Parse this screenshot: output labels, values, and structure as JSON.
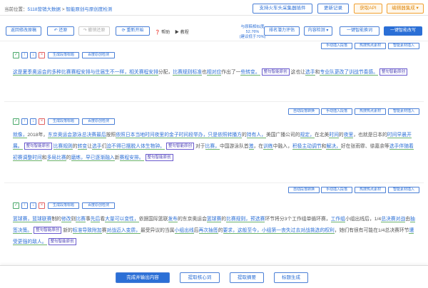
{
  "topbar": {
    "crumb_prefix": "当前位置：",
    "crumb_link": "5118营销大数据",
    "crumb_sep": ">",
    "crumb_current": "智能原创与原创度检测",
    "plugin_btn": "支持火车头采集器插件",
    "update_btn": "更新记录",
    "api_btn": "获取API",
    "editor_btn": "编辑器集成 ▾"
  },
  "toolbar": {
    "back_edit": "返回修改原稿",
    "restore": "还原",
    "undo_restore": "撤销还原",
    "restart": "重新开始",
    "help": "帮助",
    "tutorial": "教程",
    "similarity_line1": "与原稿相似度 52.76%",
    "similarity_line2": "(建议低于70%)",
    "rank_eval": "排名潜力评估",
    "content_check": "内容检测 ▾",
    "one_click_replace": "一键智能换词",
    "one_click_rewrite": "一键智能改写"
  },
  "row_tags": {
    "manual_insert": "手动插入段落",
    "hot_material": "热搜热点素材",
    "smart_insert": "智能素材插入",
    "auto_split": "自动段落转换",
    "gen_title": "生成段落标题",
    "baidu_check": "百度原创检测",
    "smart_orig": "整句智能原创"
  },
  "paragraphs": [
    {
      "segments": [
        {
          "t": "这是夏季奥运会的",
          "c": "s"
        },
        {
          "t": "多种",
          "c": "s"
        },
        {
          "t": "比赛",
          "c": "s"
        },
        {
          "t": "赛程安排",
          "c": "s"
        },
        {
          "t": "与往届生不一样，",
          "c": "s"
        },
        {
          "t": "相关",
          "c": "s"
        },
        {
          "t": "赛程安排",
          "c": "s"
        },
        {
          "t": "分配，",
          "c": "o"
        },
        {
          "t": "比赛规则",
          "c": "s"
        },
        {
          "t": "标准",
          "c": "s"
        },
        {
          "t": "也",
          "c": "o"
        },
        {
          "t": "相对应",
          "c": "s"
        },
        {
          "t": "作出了一",
          "c": "o"
        },
        {
          "t": "些",
          "c": "s"
        },
        {
          "t": "转变。",
          "c": "s"
        },
        {
          "t": "整句智能原创",
          "c": "sm"
        },
        {
          "t": "这也让",
          "c": "o"
        },
        {
          "t": "选手",
          "c": "s"
        },
        {
          "t": "和",
          "c": "o"
        },
        {
          "t": "专业队",
          "c": "s"
        },
        {
          "t": "更改了",
          "c": "s"
        },
        {
          "t": "训战",
          "c": "s"
        },
        {
          "t": "节奏感。",
          "c": "s"
        },
        {
          "t": "整句智能原创",
          "c": "sm"
        }
      ]
    },
    {
      "segments": [
        {
          "t": "就像，",
          "c": "s"
        },
        {
          "t": "2018年，",
          "c": "o"
        },
        {
          "t": "东京奥运会",
          "c": "s"
        },
        {
          "t": "游泳",
          "c": "s"
        },
        {
          "t": "总决赛",
          "c": "s"
        },
        {
          "t": "最后",
          "c": "s"
        },
        {
          "t": "按照",
          "c": "o"
        },
        {
          "t": "依照",
          "c": "s"
        },
        {
          "t": "日本当地时间",
          "c": "s"
        },
        {
          "t": "夜里的",
          "c": "s"
        },
        {
          "t": "金子",
          "c": "s"
        },
        {
          "t": "时间段",
          "c": "s"
        },
        {
          "t": "举办，",
          "c": "s"
        },
        {
          "t": "只是",
          "c": "s"
        },
        {
          "t": "依照",
          "c": "s"
        },
        {
          "t": "转播方",
          "c": "s"
        },
        {
          "t": "的",
          "c": "o"
        },
        {
          "t": "持有人，",
          "c": "s"
        },
        {
          "t": "美国广播公司的",
          "c": "o"
        },
        {
          "t": "规定，",
          "c": "s"
        },
        {
          "t": "在北美",
          "c": "o"
        },
        {
          "t": "时间",
          "c": "s"
        },
        {
          "t": "的",
          "c": "o"
        },
        {
          "t": "夜里",
          "c": "s"
        },
        {
          "t": "，也就是日本的",
          "c": "o"
        },
        {
          "t": "时间",
          "c": "s"
        },
        {
          "t": "早晨",
          "c": "s"
        },
        {
          "t": "开展。",
          "c": "s"
        },
        {
          "t": "整句智能原创",
          "c": "sm"
        },
        {
          "t": "比赛规则",
          "c": "s"
        },
        {
          "t": "的",
          "c": "o"
        },
        {
          "t": "转变",
          "c": "s"
        },
        {
          "t": "让",
          "c": "o"
        },
        {
          "t": "选手",
          "c": "s"
        },
        {
          "t": "们",
          "c": "o"
        },
        {
          "t": "迫不得已",
          "c": "s"
        },
        {
          "t": "摆脱",
          "c": "s"
        },
        {
          "t": "人体生物钟。",
          "c": "s"
        },
        {
          "t": "整句智能原创",
          "c": "sm"
        },
        {
          "t": "对于",
          "c": "o"
        },
        {
          "t": "比赛，",
          "c": "s"
        },
        {
          "t": "中国游泳队",
          "c": "o"
        },
        {
          "t": "首",
          "c": "o"
        },
        {
          "t": "激",
          "c": "s"
        },
        {
          "t": "，在",
          "c": "o"
        },
        {
          "t": "训练",
          "c": "s"
        },
        {
          "t": "中融入，",
          "c": "o"
        },
        {
          "t": "积极主动",
          "c": "s"
        },
        {
          "t": "调节",
          "c": "s"
        },
        {
          "t": "和",
          "c": "o"
        },
        {
          "t": "解决，",
          "c": "s"
        },
        {
          "t": "好在张雨霏、徐嘉余等",
          "c": "o"
        },
        {
          "t": "选手",
          "c": "s"
        },
        {
          "t": "伴随着",
          "c": "s"
        },
        {
          "t": "初赛",
          "c": "s"
        },
        {
          "t": "调整",
          "c": "s"
        },
        {
          "t": "时间",
          "c": "s"
        },
        {
          "t": "和",
          "c": "o"
        },
        {
          "t": "多局",
          "c": "s"
        },
        {
          "t": "比赛",
          "c": "s"
        },
        {
          "t": "的",
          "c": "o"
        },
        {
          "t": "磨练，",
          "c": "s"
        },
        {
          "t": "早已",
          "c": "s"
        },
        {
          "t": "逐渐融入",
          "c": "s"
        },
        {
          "t": "新",
          "c": "o"
        },
        {
          "t": "赛程安排。",
          "c": "s"
        },
        {
          "t": "整句智能原创",
          "c": "sm"
        }
      ]
    },
    {
      "segments": [
        {
          "t": "篮球赛，",
          "c": "s"
        },
        {
          "t": "篮球联赛",
          "c": "s"
        },
        {
          "t": "制的",
          "c": "o"
        },
        {
          "t": "修改",
          "c": "s"
        },
        {
          "t": "则",
          "c": "o"
        },
        {
          "t": "比赛",
          "c": "s"
        },
        {
          "t": "事",
          "c": "o"
        },
        {
          "t": "先后",
          "c": "s"
        },
        {
          "t": "看",
          "c": "o"
        },
        {
          "t": "大量",
          "c": "s"
        },
        {
          "t": "可以",
          "c": "s"
        },
        {
          "t": "变性，",
          "c": "s"
        },
        {
          "t": "依据国际篮联",
          "c": "o"
        },
        {
          "t": "发布",
          "c": "s"
        },
        {
          "t": "的东京奥运会",
          "c": "o"
        },
        {
          "t": "篮球赛",
          "c": "s"
        },
        {
          "t": "的",
          "c": "o"
        },
        {
          "t": "比赛规则，",
          "c": "s"
        },
        {
          "t": "预选赛",
          "c": "s"
        },
        {
          "t": "环节将分3个工作组单循环赛，",
          "c": "o"
        },
        {
          "t": "工作组",
          "c": "s"
        },
        {
          "t": "小组出线后，1/4",
          "c": "o"
        },
        {
          "t": "总决赛",
          "c": "s"
        },
        {
          "t": "对战",
          "c": "s"
        },
        {
          "t": "由",
          "c": "o"
        },
        {
          "t": "抽签",
          "c": "s"
        },
        {
          "t": "决策。",
          "c": "s"
        },
        {
          "t": "整句智能原创",
          "c": "sm"
        },
        {
          "t": "新的",
          "c": "o"
        },
        {
          "t": "标准",
          "c": "s"
        },
        {
          "t": "导致",
          "c": "s"
        },
        {
          "t": "附加",
          "c": "s"
        },
        {
          "t": "赛",
          "c": "o"
        },
        {
          "t": "对战",
          "c": "s"
        },
        {
          "t": "迈入",
          "c": "s"
        },
        {
          "t": "变质，",
          "c": "s"
        },
        {
          "t": "最受异议的当属",
          "c": "o"
        },
        {
          "t": "小组出线",
          "c": "s"
        },
        {
          "t": "后",
          "c": "o"
        },
        {
          "t": "再次",
          "c": "s"
        },
        {
          "t": "抽签",
          "c": "s"
        },
        {
          "t": "的",
          "c": "o"
        },
        {
          "t": "要求，",
          "c": "s"
        },
        {
          "t": "这般",
          "c": "s"
        },
        {
          "t": "至今，",
          "c": "s"
        },
        {
          "t": "小组第一",
          "c": "s"
        },
        {
          "t": "丧失",
          "c": "s"
        },
        {
          "t": "过去",
          "c": "s"
        },
        {
          "t": "对战",
          "c": "s"
        },
        {
          "t": "挑选",
          "c": "s"
        },
        {
          "t": "的权利",
          "c": "s"
        },
        {
          "t": "，她们有很有可能在1/4总决赛环节",
          "c": "o"
        },
        {
          "t": "遭受",
          "c": "s"
        },
        {
          "t": "更强的",
          "c": "s"
        },
        {
          "t": "敌人。",
          "c": "s"
        },
        {
          "t": "整句智能原创",
          "c": "sm"
        }
      ]
    }
  ],
  "bottom": {
    "finish": "完成并输出内容",
    "extract_kw": "提取核心词",
    "extract_summary": "提取摘要",
    "gen_title": "标题生成"
  }
}
